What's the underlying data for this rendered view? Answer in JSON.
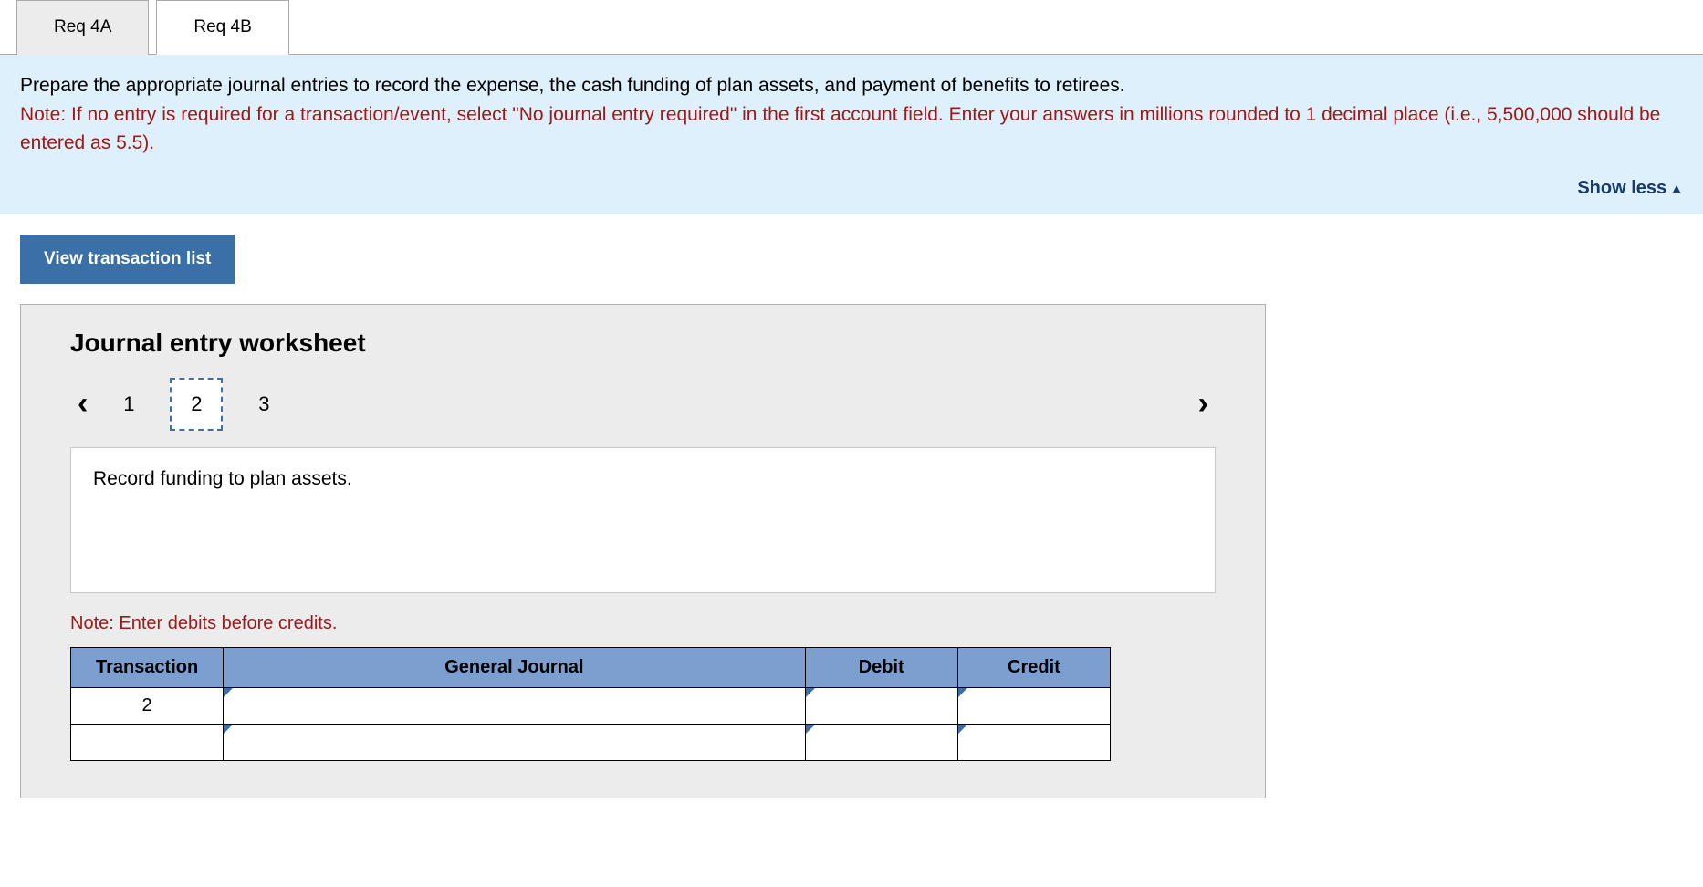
{
  "tabs": [
    {
      "label": "Req 4A",
      "active": false
    },
    {
      "label": "Req 4B",
      "active": true
    }
  ],
  "instructions": {
    "main": "Prepare the appropriate journal entries to record the expense, the cash funding of plan assets, and payment of benefits to retirees.",
    "note": "Note: If no entry is required for a transaction/event, select \"No journal entry required\" in the first account field. Enter your answers in millions rounded to 1 decimal place (i.e., 5,500,000 should be entered as 5.5).",
    "show_less": "Show less"
  },
  "view_transaction_list": "View transaction list",
  "worksheet": {
    "title": "Journal entry worksheet",
    "pages": [
      "1",
      "2",
      "3"
    ],
    "active_page_index": 1,
    "description": "Record funding to plan assets.",
    "note": "Note: Enter debits before credits.",
    "table": {
      "headers": [
        "Transaction",
        "General Journal",
        "Debit",
        "Credit"
      ],
      "rows": [
        {
          "transaction": "2",
          "gj": "",
          "debit": "",
          "credit": ""
        },
        {
          "transaction": "",
          "gj": "",
          "debit": "",
          "credit": ""
        }
      ]
    }
  }
}
